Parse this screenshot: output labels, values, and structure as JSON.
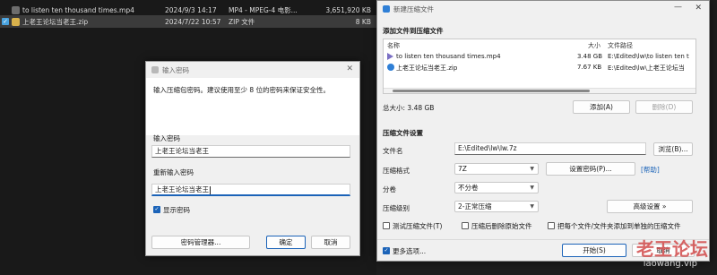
{
  "explorer": {
    "files": [
      {
        "name": "to listen ten thousand times.mp4",
        "date": "2024/9/3 14:17",
        "type": "MP4 - MPEG-4 电影...",
        "size": "3,651,920 KB"
      },
      {
        "name": "上老王论坛当老王.zip",
        "date": "2024/7/22 10:57",
        "type": "ZIP 文件",
        "size": "8 KB"
      }
    ]
  },
  "password_dialog": {
    "title": "输入密码",
    "description": "输入压缩包密码。建议使用至少 8 位的密码来保证安全性。",
    "enter_label": "输入密码",
    "enter_value": "上老王论坛当老王",
    "reenter_label": "重新输入密码",
    "reenter_value": "上老王论坛当老王",
    "show_password_label": "显示密码",
    "manager_button": "密码管理器...",
    "ok_button": "确定",
    "cancel_button": "取消"
  },
  "archive_dialog": {
    "title": "新建压缩文件",
    "section_add": "添加文件到压缩文件",
    "columns": {
      "name": "名称",
      "size": "大小",
      "path": "文件路径"
    },
    "files": [
      {
        "name": "to listen ten thousand times.mp4",
        "size": "3.48 GB",
        "path": "E:\\Edited\\lw\\to listen ten t"
      },
      {
        "name": "上老王论坛当老王.zip",
        "size": "7.67 KB",
        "path": "E:\\Edited\\lw\\上老王论坛当"
      }
    ],
    "total_label": "总大小: 3.48 GB",
    "add_button": "添加(A)",
    "delete_button": "删除(D)",
    "section_settings": "压缩文件设置",
    "filename_label": "文件名",
    "filename_value": "E:\\Edited\\lw\\lw.7z",
    "browse_button": "浏览(B)...",
    "format_label": "压缩格式",
    "format_value": "7Z",
    "set_password_button": "设置密码(P)...",
    "help_link": "[帮助]",
    "volume_label": "分卷",
    "volume_value": "不分卷",
    "level_label": "压缩级别",
    "level_value": "2-正常压缩",
    "advanced_button": "高级设置 »",
    "test_checkbox": "测试压缩文件(T)",
    "delete_after_checkbox": "压缩后删除原始文件",
    "separate_checkbox": "把每个文件/文件夹添加到单独的压缩文件",
    "more_options": "更多选项...",
    "start_button": "开始(S)",
    "cancel_button": "取消"
  },
  "watermark": {
    "text": "老王论坛",
    "url": "laowang.vip"
  }
}
